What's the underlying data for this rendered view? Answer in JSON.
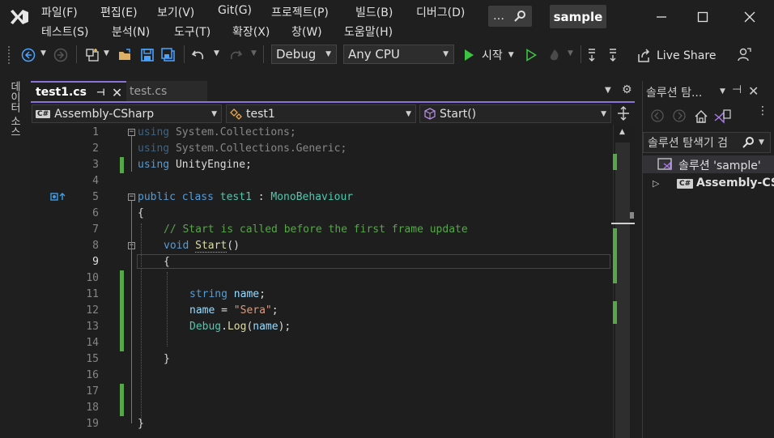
{
  "menu": {
    "row1": [
      "파일(F)",
      "편집(E)",
      "보기(V)",
      "Git(G)",
      "프로젝트(P)",
      "빌드(B)",
      "디버그(D)"
    ],
    "row2": [
      "테스트(S)",
      "분석(N)",
      "도구(T)",
      "확장(X)",
      "창(W)",
      "도움말(H)"
    ],
    "search_label": "…",
    "solution_name": "sample"
  },
  "toolbar": {
    "config": "Debug",
    "platform": "Any CPU",
    "start_label": "시작",
    "live_share": "Live Share"
  },
  "side_tab": "데이터 소스",
  "tabs": {
    "active": "test1.cs",
    "inactive": "test.cs"
  },
  "navbar": {
    "project": "Assembly-CSharp",
    "type": "test1",
    "member": "Start()"
  },
  "editor": {
    "line_numbers": [
      "1",
      "2",
      "3",
      "4",
      "5",
      "6",
      "7",
      "8",
      "9",
      "10",
      "11",
      "12",
      "13",
      "14",
      "15",
      "16",
      "17",
      "18",
      "19"
    ],
    "l1": [
      "using",
      "System.Collections;"
    ],
    "l2": [
      "using",
      "System.Collections.Generic;"
    ],
    "l3": [
      "using",
      "UnityEngine;"
    ],
    "l5": [
      "public",
      "class",
      "test1",
      ":",
      "MonoBehaviour"
    ],
    "l6": "{",
    "l7": "// Start is called before the first frame update",
    "l8": [
      "void",
      "Start",
      "()"
    ],
    "l9": "{",
    "l11": [
      "string",
      "name",
      ";"
    ],
    "l12": [
      "name",
      " = ",
      "\"Sera\"",
      ";"
    ],
    "l13": [
      "Debug",
      ".",
      "Log",
      "(",
      "name",
      ");"
    ],
    "l15": "}",
    "l19": "}"
  },
  "solution_explorer": {
    "title": "솔루션 탐...",
    "search_placeholder": "솔루션 탐색기 검",
    "root": "솔루션 'sample'",
    "project": "Assembly-CSharp",
    "cs_badge": "C#"
  },
  "colors": {
    "accent": "#8b72d9",
    "change_bar": "#57a64a",
    "start_green": "#3cc341"
  }
}
